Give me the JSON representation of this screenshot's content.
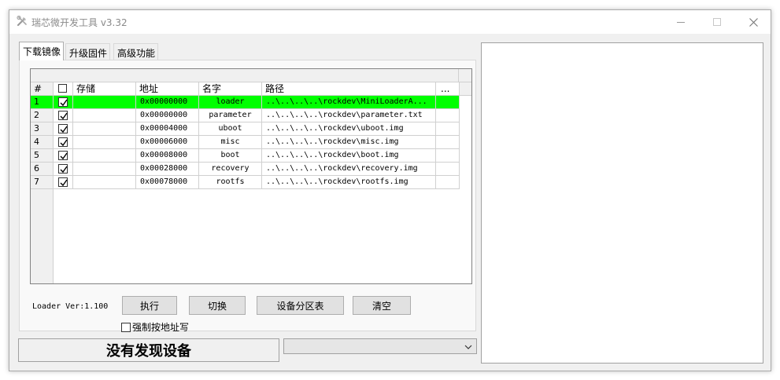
{
  "window": {
    "title": "瑞芯微开发工具 v3.32"
  },
  "tabs": [
    {
      "label": "下载镜像"
    },
    {
      "label": "升级固件"
    },
    {
      "label": "高级功能"
    }
  ],
  "table": {
    "headers": {
      "index": "#",
      "storage": "存储",
      "address": "地址",
      "name": "名字",
      "path": "路径",
      "more": "..."
    },
    "rows": [
      {
        "index": "1",
        "checked": true,
        "storage": "",
        "address": "0x00000000",
        "name": "loader",
        "path": "..\\..\\..\\..\\rockdev\\MiniLoaderA..."
      },
      {
        "index": "2",
        "checked": true,
        "storage": "",
        "address": "0x00000000",
        "name": "parameter",
        "path": "..\\..\\..\\..\\rockdev\\parameter.txt"
      },
      {
        "index": "3",
        "checked": true,
        "storage": "",
        "address": "0x00004000",
        "name": "uboot",
        "path": "..\\..\\..\\..\\rockdev\\uboot.img"
      },
      {
        "index": "4",
        "checked": true,
        "storage": "",
        "address": "0x00006000",
        "name": "misc",
        "path": "..\\..\\..\\..\\rockdev\\misc.img"
      },
      {
        "index": "5",
        "checked": true,
        "storage": "",
        "address": "0x00008000",
        "name": "boot",
        "path": "..\\..\\..\\..\\rockdev\\boot.img"
      },
      {
        "index": "6",
        "checked": true,
        "storage": "",
        "address": "0x00028000",
        "name": "recovery",
        "path": "..\\..\\..\\..\\rockdev\\recovery.img"
      },
      {
        "index": "7",
        "checked": true,
        "storage": "",
        "address": "0x00078000",
        "name": "rootfs",
        "path": "..\\..\\..\\..\\rockdev\\rootfs.img"
      }
    ],
    "highlight_color": "#00ff00"
  },
  "controls": {
    "loader_version": "Loader Ver:1.100",
    "run_label": "执行",
    "switch_label": "切换",
    "partition_label": "设备分区表",
    "clear_label": "清空",
    "force_write_label": "强制按地址写",
    "force_write_checked": false
  },
  "status": {
    "device_text": "没有发现设备",
    "device_combo_value": ""
  },
  "icons": {
    "app": "tools-icon",
    "minimize": "minimize-icon",
    "maximize": "maximize-icon",
    "close": "close-icon"
  }
}
